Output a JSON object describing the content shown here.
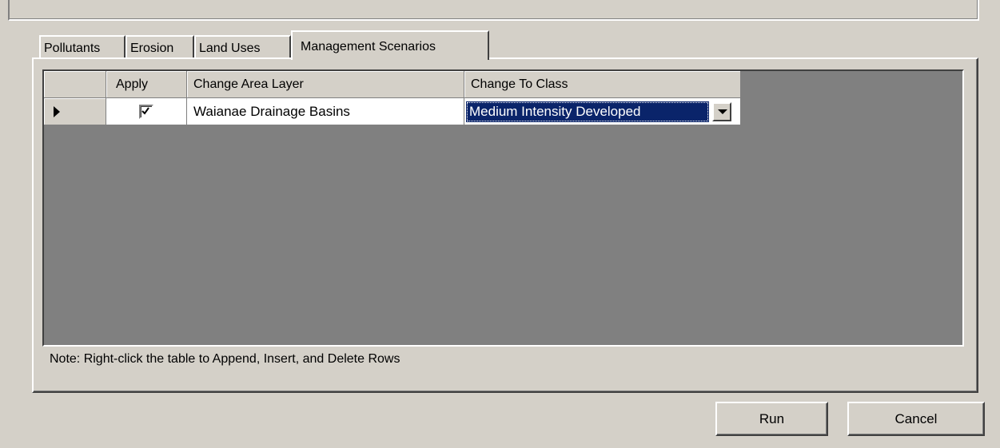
{
  "tabs": [
    {
      "label": "Pollutants",
      "active": false
    },
    {
      "label": "Erosion",
      "active": false
    },
    {
      "label": "Land Uses",
      "active": false
    },
    {
      "label": "Management Scenarios",
      "active": true
    }
  ],
  "grid": {
    "columns": [
      "Apply",
      "Change Area Layer",
      "Change To Class"
    ],
    "rows": [
      {
        "apply": true,
        "change_area_layer": "Waianae Drainage Basins",
        "change_to_class": "Medium Intensity Developed"
      }
    ]
  },
  "note": "Note: Right-click the table to Append, Insert, and Delete Rows",
  "buttons": {
    "run": "Run",
    "cancel": "Cancel"
  },
  "colors": {
    "background": "#d4d0c8",
    "grid_empty": "#808080",
    "selection": "#0a246a"
  }
}
